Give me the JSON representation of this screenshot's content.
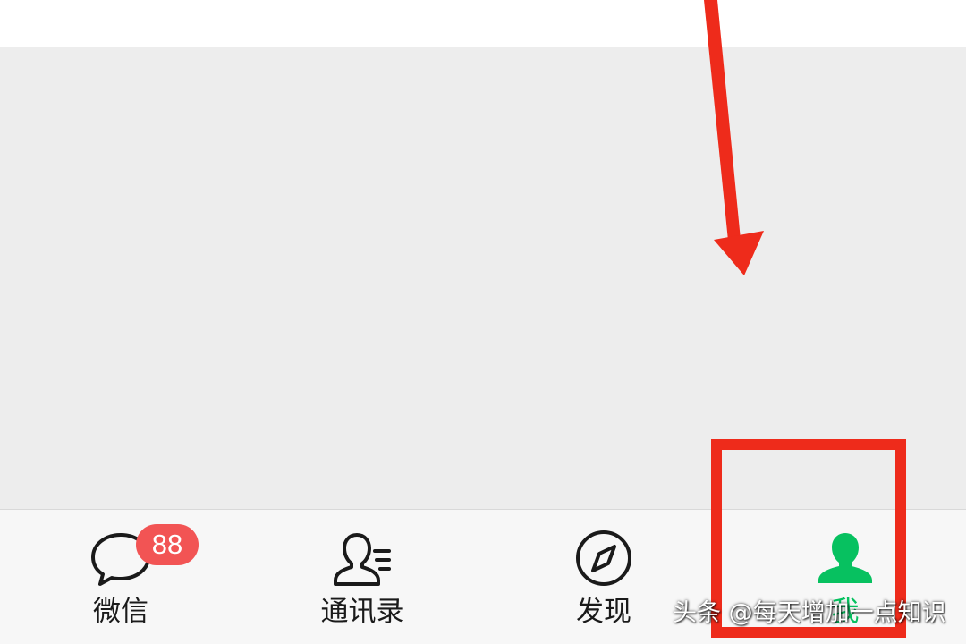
{
  "tab_bar": {
    "tabs": [
      {
        "id": "chats",
        "label": "微信",
        "icon": "chat-bubble-icon",
        "badge": "88",
        "active": false
      },
      {
        "id": "contacts",
        "label": "通讯录",
        "icon": "contacts-icon",
        "active": false
      },
      {
        "id": "discover",
        "label": "发现",
        "icon": "compass-icon",
        "active": false
      },
      {
        "id": "me",
        "label": "我",
        "icon": "person-icon",
        "active": true
      }
    ]
  },
  "annotation": {
    "arrow_color": "#ee2b1b",
    "box_color": "#ee2b1b"
  },
  "watermark": {
    "text": "头条 @每天增加一点知识"
  },
  "colors": {
    "active_tab": "#07c160",
    "badge": "#f25454",
    "background": "#ededed",
    "tab_bar_background": "#f7f7f7"
  }
}
